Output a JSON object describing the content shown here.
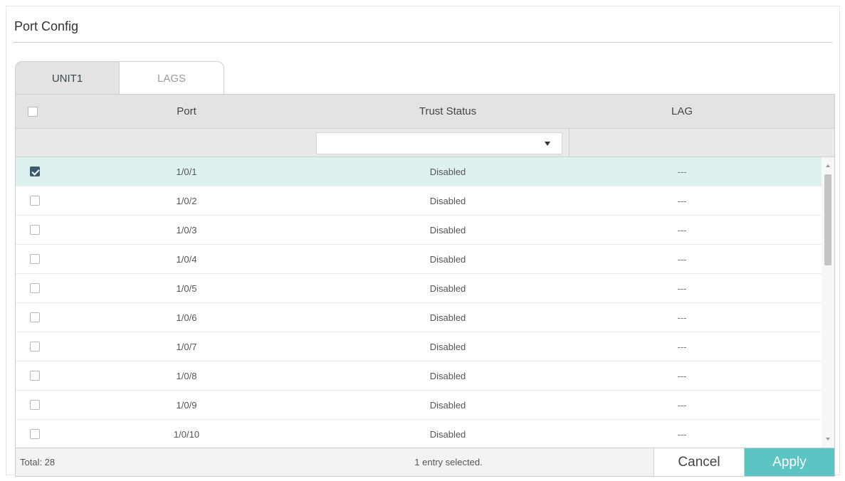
{
  "panel": {
    "title": "Port Config"
  },
  "tabs": [
    {
      "label": "UNIT1",
      "active": true
    },
    {
      "label": "LAGS",
      "active": false
    }
  ],
  "table": {
    "columns": {
      "port": "Port",
      "trust": "Trust Status",
      "lag": "LAG"
    },
    "filter": {
      "trust_status_value": ""
    },
    "rows": [
      {
        "checked": true,
        "port": "1/0/1",
        "trust_status": "Disabled",
        "lag": "---"
      },
      {
        "checked": false,
        "port": "1/0/2",
        "trust_status": "Disabled",
        "lag": "---"
      },
      {
        "checked": false,
        "port": "1/0/3",
        "trust_status": "Disabled",
        "lag": "---"
      },
      {
        "checked": false,
        "port": "1/0/4",
        "trust_status": "Disabled",
        "lag": "---"
      },
      {
        "checked": false,
        "port": "1/0/5",
        "trust_status": "Disabled",
        "lag": "---"
      },
      {
        "checked": false,
        "port": "1/0/6",
        "trust_status": "Disabled",
        "lag": "---"
      },
      {
        "checked": false,
        "port": "1/0/7",
        "trust_status": "Disabled",
        "lag": "---"
      },
      {
        "checked": false,
        "port": "1/0/8",
        "trust_status": "Disabled",
        "lag": "---"
      },
      {
        "checked": false,
        "port": "1/0/9",
        "trust_status": "Disabled",
        "lag": "---"
      },
      {
        "checked": false,
        "port": "1/0/10",
        "trust_status": "Disabled",
        "lag": "---"
      }
    ]
  },
  "footer": {
    "total": "Total: 28",
    "selection": "1 entry selected.",
    "cancel_label": "Cancel",
    "apply_label": "Apply"
  },
  "colors": {
    "accent": "#5cc5c3",
    "selected_row": "#ddf1ee",
    "header_bg": "#e3e3e3",
    "checkbox_checked": "#3d5a6c"
  },
  "icons": {
    "dropdown": "chevron-down-icon",
    "scroll_up": "scroll-up-icon",
    "scroll_down": "scroll-down-icon"
  }
}
